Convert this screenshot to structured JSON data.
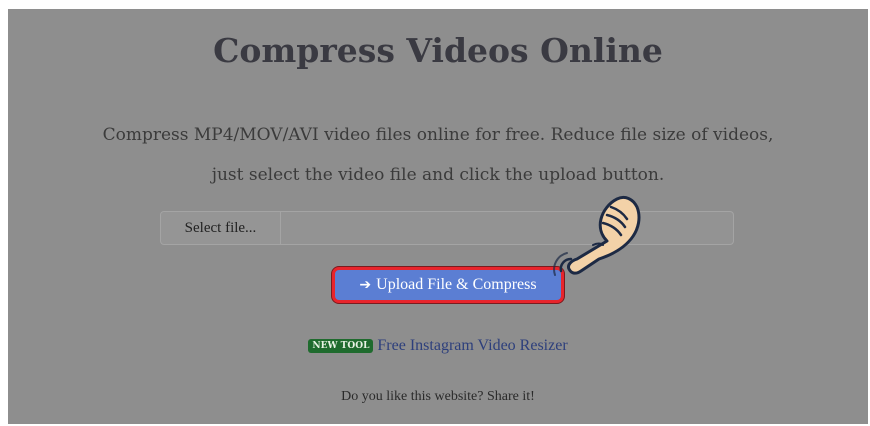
{
  "page": {
    "title": "Compress Videos Online",
    "subtitle_line1": "Compress MP4/MOV/AVI video files online for free. Reduce file size of videos,",
    "subtitle_line2": "just select the video file and click the upload button."
  },
  "file_input": {
    "button_label": "Select file...",
    "value": ""
  },
  "upload": {
    "arrow": "➔",
    "label": "Upload File & Compress"
  },
  "new_tool": {
    "badge": "NEW TOOL",
    "link_text": "Free Instagram Video Resizer"
  },
  "share": {
    "text": "Do you like this website? Share it!"
  },
  "colors": {
    "overlay": "#8e8e8e",
    "button": "#5b7ed3",
    "highlight": "#e8242c",
    "badge": "#1f6b2e"
  },
  "icons": {
    "pointer": "hand-pointer-icon"
  }
}
